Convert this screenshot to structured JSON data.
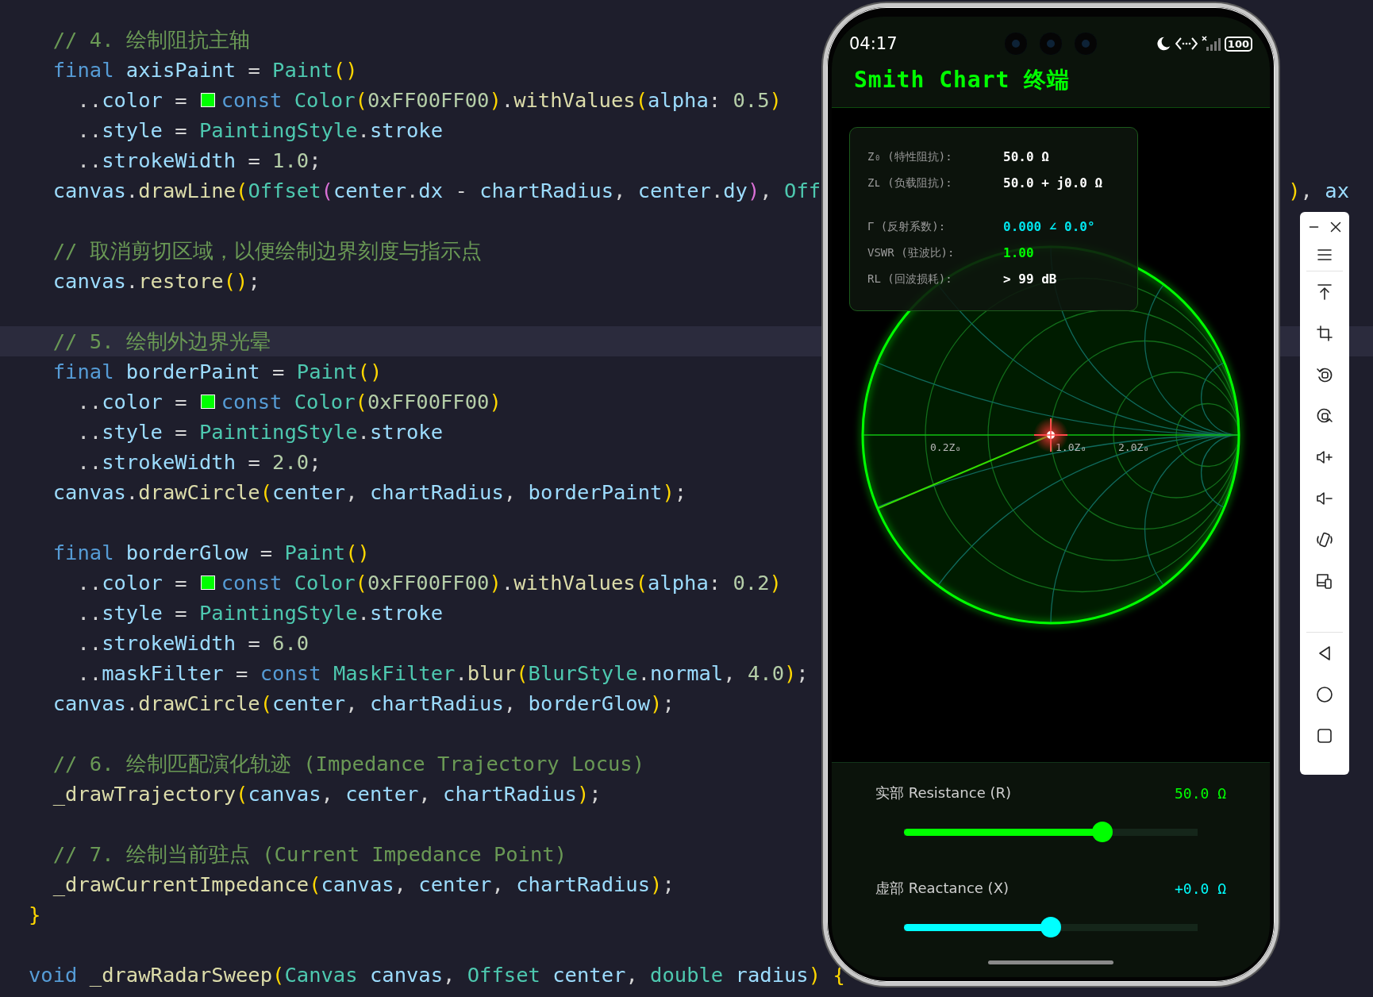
{
  "editor": {
    "blocks": [
      {
        "lines": [
          {
            "current": false,
            "text": "  // 4. 绘制阻抗主轴"
          },
          {
            "current": false,
            "text": "  final axisPaint = Paint()"
          },
          {
            "current": false,
            "text": "    ..color =",
            "swatch": {
              "color": "#00ff00"
            },
            "text_after": "const Color(0xFF00FF00).withValues(alpha: 0.5)"
          },
          {
            "current": false,
            "text": "    ..style = PaintingStyle.stroke"
          },
          {
            "current": false,
            "text": "    ..strokeWidth = 1.0;"
          },
          {
            "current": false,
            "text": "  canvas.drawLine(Offset(center.dx - chartRadius, center.dy), Off",
            "tail": "), ax"
          }
        ]
      },
      {
        "lines": [
          {
            "current": false,
            "text": "  // 取消剪切区域，以便绘制边界刻度与指示点"
          },
          {
            "current": false,
            "text": "  canvas.restore();"
          }
        ]
      },
      {
        "lines": [
          {
            "current": true,
            "text": "  // 5. 绘制外边界光晕"
          },
          {
            "current": false,
            "text": "  final borderPaint = Paint()"
          },
          {
            "current": false,
            "text": "    ..color =",
            "swatch": {
              "color": "#00ff00"
            },
            "text_after": "const Color(0xFF00FF00)"
          },
          {
            "current": false,
            "text": "    ..style = PaintingStyle.stroke"
          },
          {
            "current": false,
            "text": "    ..strokeWidth = 2.0;"
          },
          {
            "current": false,
            "text": "  canvas.drawCircle(center, chartRadius, borderPaint);"
          }
        ]
      },
      {
        "lines": [
          {
            "current": false,
            "text": "  final borderGlow = Paint()"
          },
          {
            "current": false,
            "text": "    ..color =",
            "swatch": {
              "color": "#00ff00"
            },
            "text_after": "const Color(0xFF00FF00).withValues(alpha: 0.2)"
          },
          {
            "current": false,
            "text": "    ..style = PaintingStyle.stroke"
          },
          {
            "current": false,
            "text": "    ..strokeWidth = 6.0"
          },
          {
            "current": false,
            "text": "    ..maskFilter = const MaskFilter.blur(BlurStyle.normal, 4.0);"
          },
          {
            "current": false,
            "text": "  canvas.drawCircle(center, chartRadius, borderGlow);"
          }
        ]
      },
      {
        "lines": [
          {
            "current": false,
            "text": "  // 6. 绘制匹配演化轨迹 (Impedance Trajectory Locus)"
          },
          {
            "current": false,
            "text": "  _drawTrajectory(canvas, center, chartRadius);"
          }
        ]
      },
      {
        "lines": [
          {
            "current": false,
            "text": "  // 7. 绘制当前驻点 (Current Impedance Point)"
          },
          {
            "current": false,
            "text": "  _drawCurrentImpedance(canvas, center, chartRadius);"
          },
          {
            "current": false,
            "text": "}"
          }
        ]
      },
      {
        "lines": [
          {
            "current": false,
            "text": "void _drawRadarSweep(Canvas canvas, Offset center, double radius) {"
          }
        ]
      }
    ]
  },
  "phone": {
    "status_bar": {
      "time": "04:17",
      "battery": "100"
    },
    "title": "Smith Chart 终端",
    "info_panel": {
      "groups": [
        [
          {
            "label": "Z₀ (特性阻抗):",
            "value": "50.0 Ω",
            "color": "#ffffff"
          },
          {
            "label": "Zʟ (负载阻抗):",
            "value": "50.0 + j0.0 Ω",
            "color": "#ffffff"
          }
        ],
        [
          {
            "label": "Γ (反射系数):",
            "value": "0.000 ∠ 0.0°",
            "color": "#00e5ee"
          },
          {
            "label": "VSWR (驻波比):",
            "value": "1.00",
            "color": "#00ff00"
          },
          {
            "label": "RL (回波损耗):",
            "value": "> 99 dB",
            "color": "#ffffff"
          }
        ]
      ]
    },
    "chart_labels": [
      "0.2Z₀",
      "1.0Z₀",
      "2.0Z₀"
    ],
    "sliders": [
      {
        "label": "实部 Resistance (R)",
        "reading": "50.0 Ω",
        "level": 0.676,
        "color": "#00ff00"
      },
      {
        "label": "虚部 Reactance (X)",
        "reading": "+0.0 Ω",
        "level": 0.5,
        "color": "#00ffff"
      }
    ]
  },
  "emulator_toolbar": {
    "window_controls": [
      {
        "kind": "minimize"
      },
      {
        "kind": "close"
      }
    ],
    "groups": [
      [
        {
          "kind": "menu"
        }
      ],
      [
        {
          "kind": "pin-top"
        },
        {
          "kind": "crop"
        },
        {
          "kind": "rotate-left"
        },
        {
          "kind": "rotate-right"
        },
        {
          "kind": "volume-up"
        },
        {
          "kind": "volume-down"
        },
        {
          "kind": "shake"
        },
        {
          "kind": "multi-device"
        }
      ],
      [
        {
          "kind": "back"
        },
        {
          "kind": "home"
        },
        {
          "kind": "recents"
        }
      ]
    ]
  }
}
